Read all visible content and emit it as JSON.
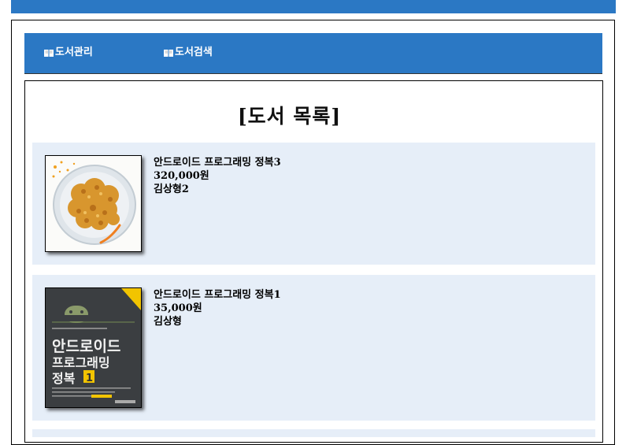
{
  "nav": {
    "items": [
      {
        "label": "도서관리",
        "icon": "book-icon"
      },
      {
        "label": "도서검색",
        "icon": "book-icon"
      }
    ]
  },
  "page": {
    "title": "[도서 목록]"
  },
  "books": [
    {
      "title": "안드로이드 프로그래밍 정복3",
      "price": "320,000원",
      "author": "김상형2",
      "image": "fried-chicken-image"
    },
    {
      "title": "안드로이드 프로그래밍 정복1",
      "price": "35,000원",
      "author": "김상형",
      "image": "android-book-cover",
      "cover": {
        "line1": "안드로이드",
        "line2": "프로그래밍",
        "line3": "정복",
        "volume": "1"
      }
    }
  ],
  "colors": {
    "primary": "#2b78c4",
    "card_bg": "#e6eef8"
  }
}
